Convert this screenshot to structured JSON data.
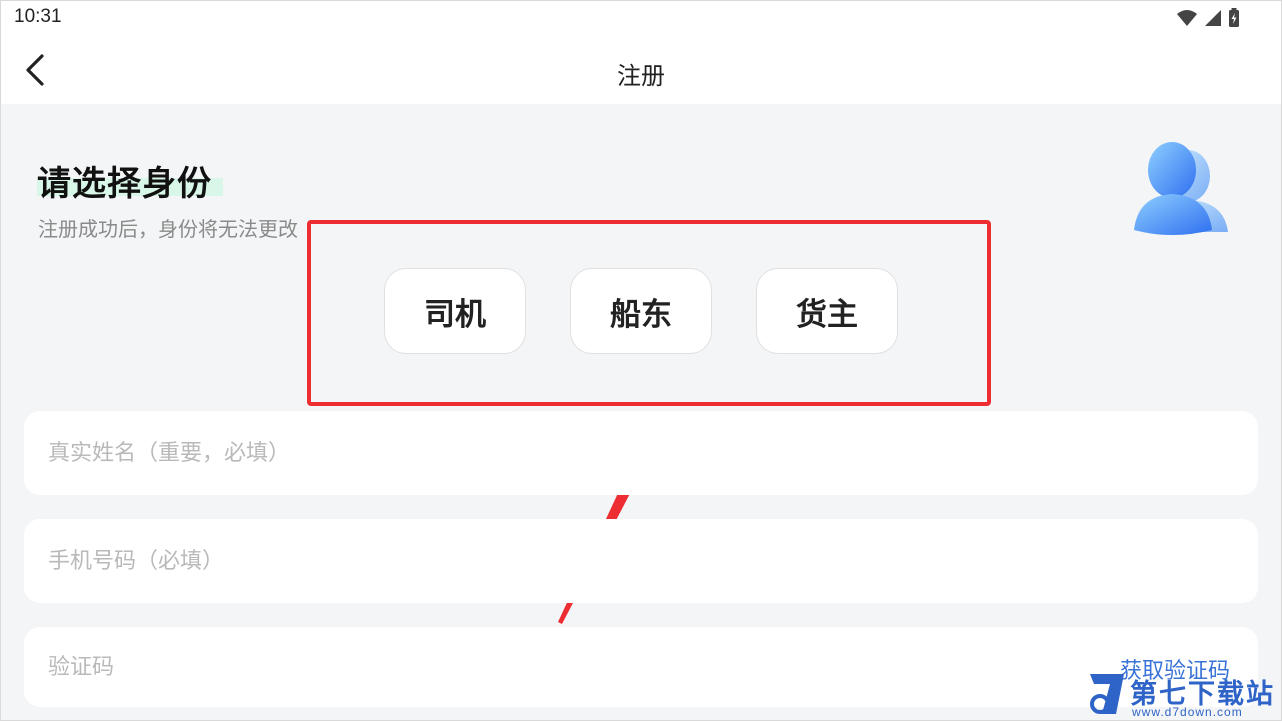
{
  "status_bar": {
    "time": "10:31"
  },
  "nav": {
    "title": "注册"
  },
  "identity": {
    "heading": "请选择身份",
    "subheading": "注册成功后，身份将无法更改",
    "roles": [
      {
        "label": "司机"
      },
      {
        "label": "船东"
      },
      {
        "label": "货主"
      }
    ]
  },
  "form": {
    "name_placeholder": "真实姓名（重要，必填）",
    "phone_placeholder": "手机号码（必填）",
    "code_placeholder": "验证码",
    "get_code_label": "获取验证码"
  },
  "watermark": {
    "text": "第七下载站",
    "url": "www.d7down.com"
  },
  "colors": {
    "accent": "#3a73d8",
    "annotation": "#ee2d33",
    "highlight": "#d8f7e9"
  }
}
